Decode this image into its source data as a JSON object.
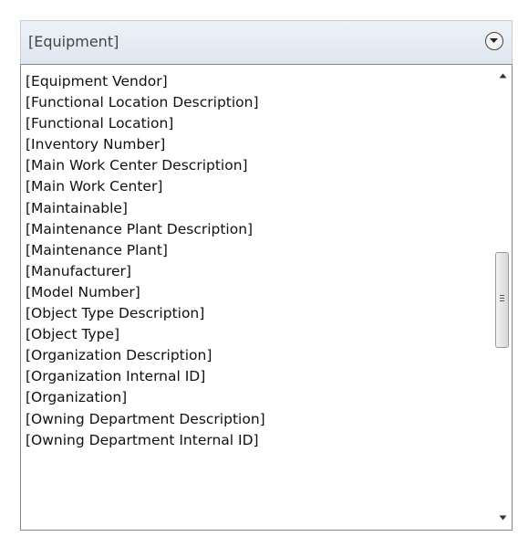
{
  "dropdown": {
    "selected_value": "[Equipment]",
    "icon": "chevron-down-circle-icon"
  },
  "list": {
    "items": [
      "[Equipment Vendor]",
      "[Functional Location Description]",
      "[Functional Location]",
      "[Inventory Number]",
      "[Main Work Center Description]",
      "[Main Work Center]",
      "[Maintainable]",
      "[Maintenance Plant Description]",
      "[Maintenance Plant]",
      "[Manufacturer]",
      "[Model Number]",
      "[Object Type Description]",
      "[Object Type]",
      "[Organization Description]",
      "[Organization Internal ID]",
      "[Organization]",
      "[Owning Department Description]",
      "[Owning Department Internal ID]"
    ]
  },
  "scrollbar": {
    "up_icon": "arrow-up-icon",
    "down_icon": "arrow-down-icon",
    "position_fraction": 0.45
  }
}
